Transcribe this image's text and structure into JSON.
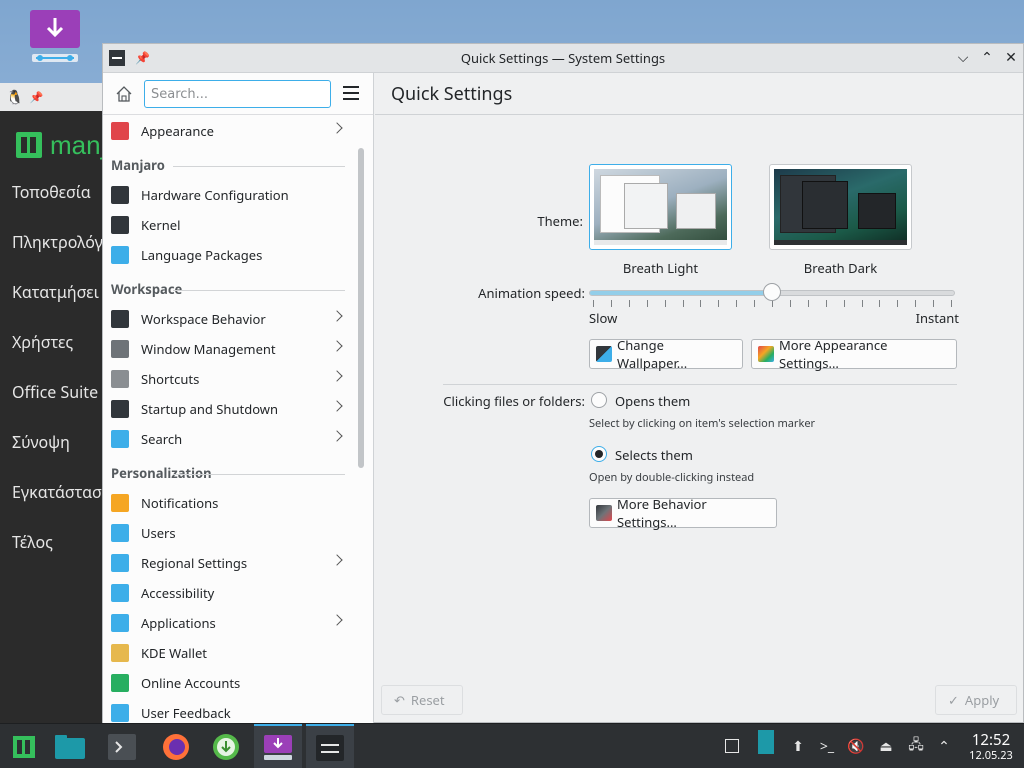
{
  "window": {
    "title": "Quick Settings — System Settings"
  },
  "background_installer": {
    "logo_text": "manj",
    "steps": [
      "Τοποθεσία",
      "Πληκτρολόγ",
      "Κατατμήσει",
      "Χρήστες",
      "Office Suite",
      "Σύνοψη",
      "Εγκατάστασ",
      "Τέλος"
    ]
  },
  "sidebar": {
    "search_placeholder": "Search...",
    "items": [
      {
        "type": "item",
        "label": "Appearance",
        "icon": "appearance-icon",
        "color": "#e0454b",
        "chevron": true
      },
      {
        "type": "section",
        "label": "Manjaro"
      },
      {
        "type": "item",
        "label": "Hardware Configuration",
        "icon": "hardware-icon",
        "color": "#31363b",
        "chevron": false
      },
      {
        "type": "item",
        "label": "Kernel",
        "icon": "kernel-icon",
        "color": "#31363b",
        "chevron": false
      },
      {
        "type": "item",
        "label": "Language Packages",
        "icon": "language-icon",
        "color": "#3daee9",
        "chevron": false
      },
      {
        "type": "section",
        "label": "Workspace"
      },
      {
        "type": "item",
        "label": "Workspace Behavior",
        "icon": "workspace-icon",
        "color": "#31363b",
        "chevron": true
      },
      {
        "type": "item",
        "label": "Window Management",
        "icon": "window-icon",
        "color": "#6e7378",
        "chevron": true
      },
      {
        "type": "item",
        "label": "Shortcuts",
        "icon": "keyboard-icon",
        "color": "#8a8e92",
        "chevron": true
      },
      {
        "type": "item",
        "label": "Startup and Shutdown",
        "icon": "startup-icon",
        "color": "#31363b",
        "chevron": true
      },
      {
        "type": "item",
        "label": "Search",
        "icon": "search-icon",
        "color": "#3daee9",
        "chevron": true
      },
      {
        "type": "section",
        "label": "Personalization"
      },
      {
        "type": "item",
        "label": "Notifications",
        "icon": "bell-icon",
        "color": "#f5a623",
        "chevron": false
      },
      {
        "type": "item",
        "label": "Users",
        "icon": "users-icon",
        "color": "#3daee9",
        "chevron": false
      },
      {
        "type": "item",
        "label": "Regional Settings",
        "icon": "regional-icon",
        "color": "#3daee9",
        "chevron": true
      },
      {
        "type": "item",
        "label": "Accessibility",
        "icon": "accessibility-icon",
        "color": "#3daee9",
        "chevron": false
      },
      {
        "type": "item",
        "label": "Applications",
        "icon": "applications-icon",
        "color": "#3daee9",
        "chevron": true
      },
      {
        "type": "item",
        "label": "KDE Wallet",
        "icon": "wallet-icon",
        "color": "#e6b84d",
        "chevron": false
      },
      {
        "type": "item",
        "label": "Online Accounts",
        "icon": "online-accounts-icon",
        "color": "#27ae60",
        "chevron": false
      },
      {
        "type": "item",
        "label": "User Feedback",
        "icon": "feedback-icon",
        "color": "#3daee9",
        "chevron": false
      }
    ]
  },
  "content": {
    "heading": "Quick Settings",
    "theme_label": "Theme:",
    "themes": [
      {
        "name": "Breath Light"
      },
      {
        "name": "Breath Dark"
      }
    ],
    "animation_label": "Animation speed:",
    "animation_speed_fraction": 0.5,
    "slider_min_label": "Slow",
    "slider_max_label": "Instant",
    "change_wallpaper_label": "Change Wallpaper...",
    "more_appearance_label": "More Appearance Settings...",
    "clicking_label": "Clicking files or folders:",
    "option_open_label": "Opens them",
    "option_open_hint": "Select by clicking on item's selection marker",
    "option_select_label": "Selects them",
    "option_select_hint": "Open by double-clicking instead",
    "selected_option": "select",
    "more_behavior_label": "More Behavior Settings...",
    "reset_label": "Reset",
    "apply_label": "Apply"
  },
  "taskbar": {
    "time": "12:52",
    "date": "12.05.23"
  }
}
